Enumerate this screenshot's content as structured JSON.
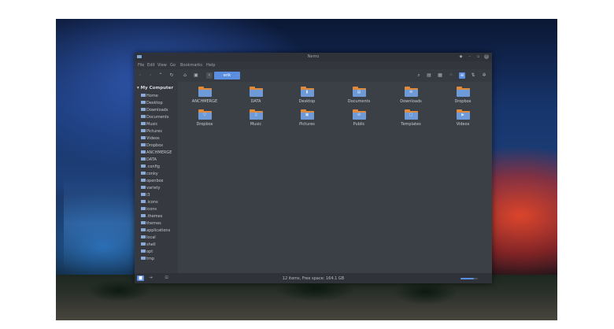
{
  "window": {
    "title": "Nemo",
    "controls": {
      "pin": "◆",
      "minimize": "–",
      "maximize": "▫",
      "close": "×"
    }
  },
  "menu": [
    "File",
    "Edit",
    "View",
    "Go",
    "Bookmarks",
    "Help"
  ],
  "toolbar": {
    "back": "‹",
    "forward": "›",
    "up": "⌃",
    "reload": "↻",
    "home": "⌂",
    "computer": "▣",
    "path_prev": "‹",
    "path_segment": "erik",
    "path_next": "›",
    "right": [
      "⌕",
      "▤",
      "▦",
      "⁘",
      "≡",
      "⇅",
      "✲"
    ]
  },
  "sidebar": {
    "header": "▾ My Computer",
    "items": [
      "Home",
      "Desktop",
      "Downloads",
      "Documents",
      "Music",
      "Pictures",
      "Videos",
      "Dropbox",
      "ANCHMERGE",
      "DATA",
      ".config",
      "conky",
      "openbox",
      "variety",
      "i3",
      ".icons",
      "icons",
      ".themes",
      "themes",
      "applications",
      "local",
      "shell",
      "opt",
      "tmp"
    ]
  },
  "files": [
    {
      "name": "ANCHMERGE",
      "glyph": ""
    },
    {
      "name": "DATA",
      "glyph": ""
    },
    {
      "name": "Desktop",
      "glyph": "▮"
    },
    {
      "name": "Documents",
      "glyph": "▤"
    },
    {
      "name": "Downloads",
      "glyph": "⊕"
    },
    {
      "name": "Dropbox",
      "glyph": ""
    },
    {
      "name": "Dropbox",
      "glyph": "▽"
    },
    {
      "name": "Music",
      "glyph": "♫"
    },
    {
      "name": "Pictures",
      "glyph": "▣"
    },
    {
      "name": "Public",
      "glyph": "⊘"
    },
    {
      "name": "Templates",
      "glyph": "▢"
    },
    {
      "name": "Videos",
      "glyph": "▶"
    }
  ],
  "status": {
    "text": "12 items, Free space: 164.1 GB",
    "buttons": [
      "▆",
      "⇥",
      "⊡"
    ],
    "zoom_level": 0.75
  },
  "colors": {
    "accent": "#5b8ee0",
    "folder": "#6e9ad8",
    "folder_tab": "#e08a3c"
  }
}
